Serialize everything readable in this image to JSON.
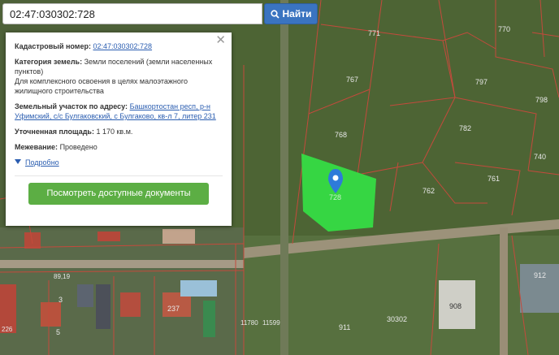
{
  "search": {
    "value": "02:47:030302:728",
    "button": "Найти"
  },
  "panel": {
    "cadastral_label": "Кадастровый номер:",
    "cadastral_value": "02:47:030302:728",
    "category_label": "Категория земель:",
    "category_value": "Земли поселений (земли населенных пунктов)",
    "usage": "Для комплексного освоения в целях малоэтажного жилищного строительства",
    "address_label": "Земельный участок по адресу:",
    "address_value": "Башкортостан респ, р-н Уфимский, с/с Булгаковский, с Булгаково, кв-л 7, литер 231",
    "area_label": "Уточненная площадь:",
    "area_value": "1 170 кв.м.",
    "survey_label": "Межевание:",
    "survey_value": "Проведено",
    "more": "Подробно",
    "docs_button": "Посмотреть доступные документы"
  },
  "map": {
    "selected_parcel": "728",
    "parcel_labels": [
      "771",
      "770",
      "767",
      "797",
      "798",
      "768",
      "782",
      "740",
      "762",
      "761",
      "912",
      "908",
      "911",
      "30302",
      "5",
      "237",
      "3",
      "89,19",
      "11780",
      "11599",
      "226"
    ],
    "colors": {
      "selected": "#35dc45",
      "boundary": "#c44a3c",
      "accent": "#3a74c0"
    }
  }
}
